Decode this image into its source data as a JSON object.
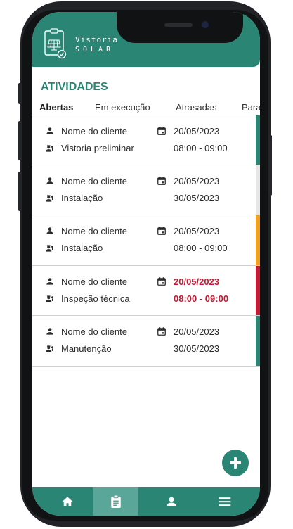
{
  "app": {
    "logo_line1": "Vistoria",
    "logo_line2": "SOLAR",
    "brand_color": "#2a8574"
  },
  "page_title": "ATIVIDADES",
  "tabs": [
    {
      "label": "Abertas",
      "active": true
    },
    {
      "label": "Em execução",
      "active": false
    },
    {
      "label": "Atrasadas",
      "active": false
    },
    {
      "label": "Para",
      "active": false
    }
  ],
  "activities": [
    {
      "client": "Nome do cliente",
      "service": "Vistoria preliminar",
      "date": "20/05/2023",
      "detail": "08:00 - 09:00",
      "status_color": "#2a8574",
      "late": false
    },
    {
      "client": "Nome do cliente",
      "service": "Instalação",
      "date": "20/05/2023",
      "detail": "30/05/2023",
      "status_color": "#e6e6e6",
      "late": false
    },
    {
      "client": "Nome do cliente",
      "service": "Instalação",
      "date": "20/05/2023",
      "detail": "08:00 - 09:00",
      "status_color": "#f0a21c",
      "late": false
    },
    {
      "client": "Nome do cliente",
      "service": "Inspeção técnica",
      "date": "20/05/2023",
      "detail": "08:00 - 09:00",
      "status_color": "#c41a35",
      "late": true
    },
    {
      "client": "Nome do cliente",
      "service": "Manutenção",
      "date": "20/05/2023",
      "detail": "30/05/2023",
      "status_color": "#2a8574",
      "late": false
    }
  ],
  "icons": {
    "client": "person-icon",
    "service": "worker-icon",
    "date": "calendar-icon",
    "fab": "plus-circle-icon"
  },
  "bottom_nav": [
    {
      "icon": "home-icon",
      "active": false
    },
    {
      "icon": "clipboard-icon",
      "active": true
    },
    {
      "icon": "person-icon",
      "active": false
    },
    {
      "icon": "menu-icon",
      "active": false
    }
  ]
}
